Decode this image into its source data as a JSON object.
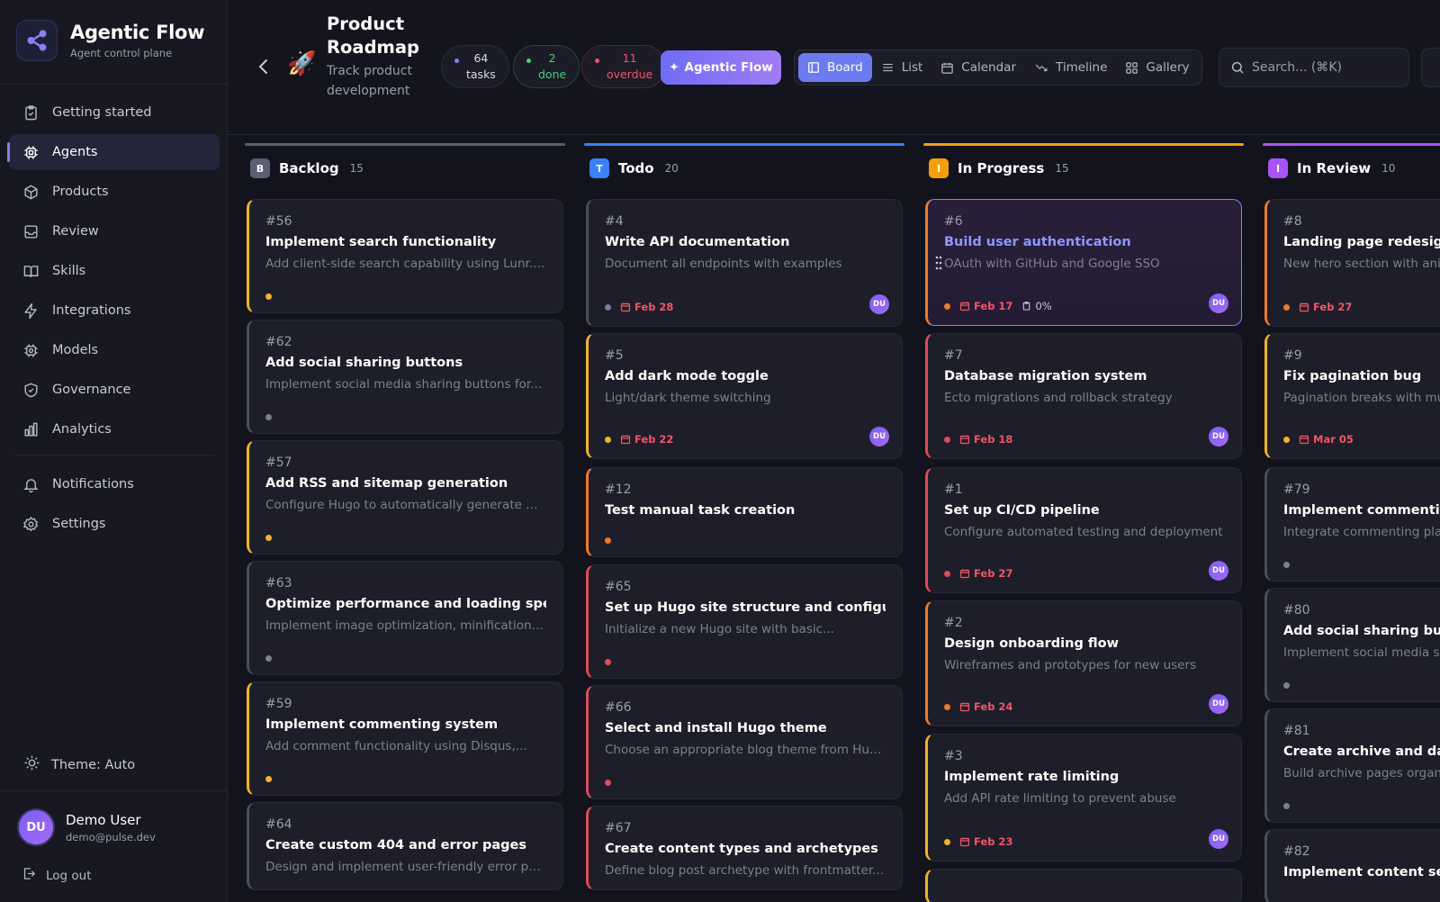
{
  "brand": {
    "title": "Agentic Flow",
    "subtitle": "Agent control plane"
  },
  "nav": {
    "items": [
      {
        "label": "Getting started",
        "icon": "clipboard-check-icon"
      },
      {
        "label": "Agents",
        "icon": "cpu-icon",
        "active": true
      },
      {
        "label": "Products",
        "icon": "box-icon"
      },
      {
        "label": "Review",
        "icon": "inbox-icon"
      },
      {
        "label": "Skills",
        "icon": "book-icon"
      },
      {
        "label": "Integrations",
        "icon": "bolt-icon"
      },
      {
        "label": "Models",
        "icon": "chip-icon"
      },
      {
        "label": "Governance",
        "icon": "shield-check-icon"
      },
      {
        "label": "Analytics",
        "icon": "bar-chart-icon"
      }
    ],
    "secondary": [
      {
        "label": "Notifications",
        "icon": "bell-icon"
      },
      {
        "label": "Settings",
        "icon": "gear-icon"
      }
    ]
  },
  "theme": {
    "label": "Theme: Auto"
  },
  "user": {
    "initials": "DU",
    "name": "Demo User",
    "email": "demo@pulse.dev",
    "logout": "Log out"
  },
  "header": {
    "title": "Product Roadmap",
    "emoji": "🚀",
    "description": "Track product development",
    "stats": {
      "tasks": {
        "value": "64",
        "label": "tasks"
      },
      "done": {
        "value": "2",
        "label": "done"
      },
      "overdue": {
        "value": "11",
        "label": "overdue"
      }
    },
    "agentic_button": "Agentic Flow",
    "views": [
      "Board",
      "List",
      "Calendar",
      "Timeline",
      "Gallery"
    ],
    "active_view": "Board",
    "search_placeholder": "Search... (⌘K)"
  },
  "colors": {
    "accent": "#8b7cf6",
    "backlog": "#7c7f91",
    "todo": "#3b82f6",
    "in_progress": "#f59e0b",
    "in_review": "#a855f7",
    "overdue": "#f2546a"
  },
  "columns": [
    {
      "name": "Backlog",
      "badge": "B",
      "count": "15",
      "cards": [
        {
          "id": "#56",
          "title": "Implement search functionality",
          "desc": "Add client-side search capability using Lunr.js ...",
          "priority": "yellow"
        },
        {
          "id": "#62",
          "title": "Add social sharing buttons",
          "desc": "Implement social media sharing buttons for...",
          "priority": "gray"
        },
        {
          "id": "#57",
          "title": "Add RSS and sitemap generation",
          "desc": "Configure Hugo to automatically generate RSS...",
          "priority": "yellow"
        },
        {
          "id": "#63",
          "title": "Optimize performance and loading speed",
          "desc": "Implement image optimization, minification of...",
          "priority": "gray"
        },
        {
          "id": "#59",
          "title": "Implement commenting system",
          "desc": "Add comment functionality using Disqus,...",
          "priority": "yellow"
        },
        {
          "id": "#64",
          "title": "Create custom 404 and error pages",
          "desc": "Design and implement user-friendly error pag...",
          "priority": "gray"
        }
      ]
    },
    {
      "name": "Todo",
      "badge": "T",
      "count": "20",
      "cards": [
        {
          "id": "#4",
          "title": "Write API documentation",
          "desc": "Document all endpoints with examples",
          "priority": "gray",
          "due": "Feb 28",
          "assignee": "DU"
        },
        {
          "id": "#5",
          "title": "Add dark mode toggle",
          "desc": "Light/dark theme switching",
          "priority": "yellow",
          "due": "Feb 22",
          "assignee": "DU"
        },
        {
          "id": "#12",
          "title": "Test manual task creation",
          "desc": "",
          "priority": "orange"
        },
        {
          "id": "#65",
          "title": "Set up Hugo site structure and configuration",
          "desc": "Initialize a new Hugo site with basic...",
          "priority": "red"
        },
        {
          "id": "#66",
          "title": "Select and install Hugo theme",
          "desc": "Choose an appropriate blog theme from Hugo...",
          "priority": "red"
        },
        {
          "id": "#67",
          "title": "Create content types and archetypes",
          "desc": "Define blog post archetype with frontmatter...",
          "priority": "red"
        }
      ]
    },
    {
      "name": "In Progress",
      "badge": "I",
      "count": "15",
      "cards": [
        {
          "id": "#6",
          "title": "Build user authentication",
          "desc": "OAuth with GitHub and Google SSO",
          "priority": "orange",
          "due": "Feb 17",
          "progress": "0%",
          "assignee": "DU"
        },
        {
          "id": "#7",
          "title": "Database migration system",
          "desc": "Ecto migrations and rollback strategy",
          "priority": "red",
          "due": "Feb 18",
          "assignee": "DU"
        },
        {
          "id": "#1",
          "title": "Set up CI/CD pipeline",
          "desc": "Configure automated testing and deployment",
          "priority": "red",
          "due": "Feb 27",
          "assignee": "DU"
        },
        {
          "id": "#2",
          "title": "Design onboarding flow",
          "desc": "Wireframes and prototypes for new users",
          "priority": "orange",
          "due": "Feb 24",
          "assignee": "DU"
        },
        {
          "id": "#3",
          "title": "Implement rate limiting",
          "desc": "Add API rate limiting to prevent abuse",
          "priority": "yellow",
          "due": "Feb 23",
          "assignee": "DU"
        }
      ]
    },
    {
      "name": "In Review",
      "badge": "I",
      "count": "10",
      "cards": [
        {
          "id": "#8",
          "title": "Landing page redesign",
          "desc": "New hero section with anim",
          "priority": "orange",
          "due": "Feb 27"
        },
        {
          "id": "#9",
          "title": "Fix pagination bug",
          "desc": "Pagination breaks with mul",
          "priority": "yellow",
          "due": "Mar 05"
        },
        {
          "id": "#79",
          "title": "Implement commenting s",
          "desc": "Integrate commenting plat",
          "priority": "gray"
        },
        {
          "id": "#80",
          "title": "Add social sharing buttor",
          "desc": "Implement social media sh",
          "priority": "gray"
        },
        {
          "id": "#81",
          "title": "Create archive and date-",
          "desc": "Build archive pages organi",
          "priority": "gray"
        },
        {
          "id": "#82",
          "title": "Implement content series",
          "desc": "",
          "priority": "gray"
        }
      ]
    }
  ]
}
